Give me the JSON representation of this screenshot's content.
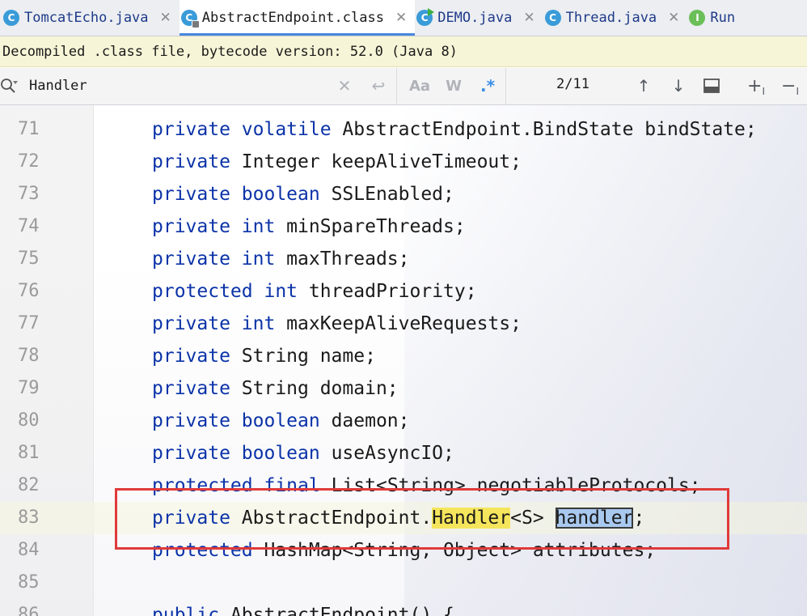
{
  "tabs": [
    {
      "label": "TomcatEcho.java",
      "icon": "C",
      "icon_name": "class-icon",
      "active": false
    },
    {
      "label": "AbstractEndpoint.class",
      "icon": "C",
      "icon_name": "class-locked-icon",
      "active": true
    },
    {
      "label": "DEMO.java",
      "icon": "C",
      "icon_name": "runnable-class-icon",
      "active": false
    },
    {
      "label": "Thread.java",
      "icon": "C",
      "icon_name": "class-icon",
      "active": false
    },
    {
      "label": "Run",
      "icon": "I",
      "icon_name": "interface-icon",
      "active": false
    }
  ],
  "banner": {
    "text": "Decompiled .class file, bytecode version: 52.0 (Java 8)"
  },
  "search": {
    "value": "Handler",
    "match_count": "2/11",
    "match_case_label": "Aa",
    "words_label": "W",
    "regex_label": ".*"
  },
  "editor": {
    "lines": [
      {
        "num": "71",
        "tokens": [
          {
            "t": "private ",
            "k": true
          },
          {
            "t": "volatile ",
            "k": true
          },
          {
            "t": "AbstractEndpoint.BindState bindState;"
          }
        ]
      },
      {
        "num": "72",
        "tokens": [
          {
            "t": "private ",
            "k": true
          },
          {
            "t": "Integer keepAliveTimeout;"
          }
        ]
      },
      {
        "num": "73",
        "tokens": [
          {
            "t": "private ",
            "k": true
          },
          {
            "t": "boolean ",
            "k": true
          },
          {
            "t": "SSLEnabled;"
          }
        ]
      },
      {
        "num": "74",
        "tokens": [
          {
            "t": "private ",
            "k": true
          },
          {
            "t": "int ",
            "k": true
          },
          {
            "t": "minSpareThreads;"
          }
        ]
      },
      {
        "num": "75",
        "tokens": [
          {
            "t": "private ",
            "k": true
          },
          {
            "t": "int ",
            "k": true
          },
          {
            "t": "maxThreads;"
          }
        ]
      },
      {
        "num": "76",
        "tokens": [
          {
            "t": "protected ",
            "k": true
          },
          {
            "t": "int ",
            "k": true
          },
          {
            "t": "threadPriority;"
          }
        ]
      },
      {
        "num": "77",
        "tokens": [
          {
            "t": "private ",
            "k": true
          },
          {
            "t": "int ",
            "k": true
          },
          {
            "t": "maxKeepAliveRequests;"
          }
        ]
      },
      {
        "num": "78",
        "tokens": [
          {
            "t": "private ",
            "k": true
          },
          {
            "t": "String name;"
          }
        ]
      },
      {
        "num": "79",
        "tokens": [
          {
            "t": "private ",
            "k": true
          },
          {
            "t": "String domain;"
          }
        ]
      },
      {
        "num": "80",
        "tokens": [
          {
            "t": "private ",
            "k": true
          },
          {
            "t": "boolean ",
            "k": true
          },
          {
            "t": "daemon;"
          }
        ]
      },
      {
        "num": "81",
        "tokens": [
          {
            "t": "private ",
            "k": true
          },
          {
            "t": "boolean ",
            "k": true
          },
          {
            "t": "useAsyncIO;"
          }
        ]
      },
      {
        "num": "82",
        "tokens": [
          {
            "t": "protected ",
            "k": true
          },
          {
            "t": "final ",
            "k": true
          },
          {
            "t": "List<String> negotiableProtocols;"
          }
        ]
      },
      {
        "num": "83",
        "tokens": [
          {
            "t": "private ",
            "k": true
          },
          {
            "t": "AbstractEndpoint."
          },
          {
            "t": "Handler",
            "h": "yellow"
          },
          {
            "t": "<S> "
          },
          {
            "t": "handler",
            "h": "blue"
          },
          {
            "t": ";"
          }
        ]
      },
      {
        "num": "84",
        "tokens": [
          {
            "t": "protected ",
            "k": true
          },
          {
            "t": "HashMap<String, Object> attributes;"
          }
        ]
      },
      {
        "num": "85",
        "tokens": []
      },
      {
        "num": "86",
        "tokens": [
          {
            "t": "public ",
            "k": true
          },
          {
            "t": "AbstractEndpoint() {"
          }
        ]
      }
    ]
  }
}
